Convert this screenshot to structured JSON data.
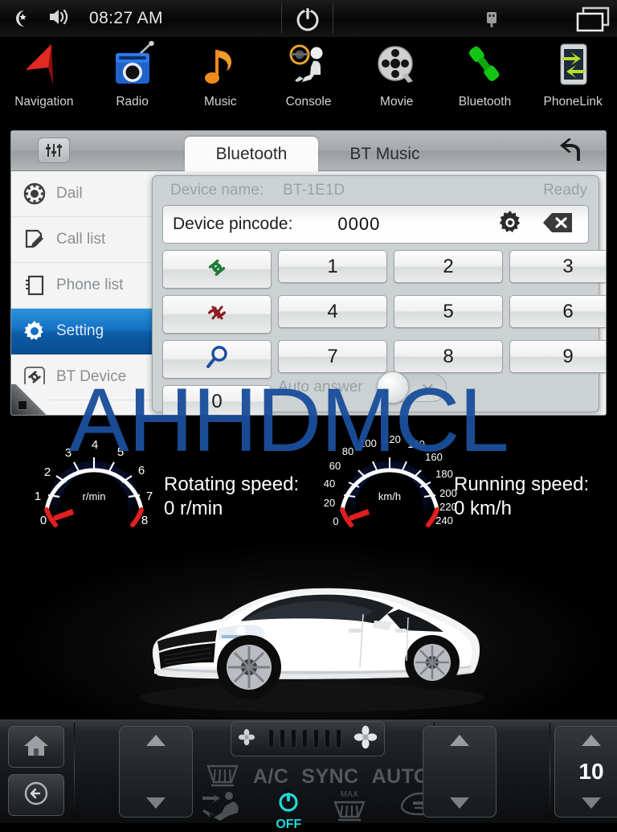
{
  "statusbar": {
    "time": "08:27 AM",
    "icons": [
      "moon-star-icon",
      "volume-icon",
      "power-icon",
      "usb-icon",
      "window-icon"
    ]
  },
  "dock": {
    "apps": [
      {
        "label": "Navigation",
        "icon": "navigation-arrow-icon"
      },
      {
        "label": "Radio",
        "icon": "radio-icon"
      },
      {
        "label": "Music",
        "icon": "music-note-icon"
      },
      {
        "label": "Console",
        "icon": "console-driver-icon"
      },
      {
        "label": "Movie",
        "icon": "film-reel-icon"
      },
      {
        "label": "Bluetooth",
        "icon": "bluetooth-phone-icon"
      },
      {
        "label": "PhoneLink",
        "icon": "phonelink-icon"
      }
    ]
  },
  "bt_panel": {
    "eq_icon": "equalizer-icon",
    "back_icon": "back-arrow-icon",
    "tabs": [
      {
        "label": "Bluetooth",
        "active": true
      },
      {
        "label": "BT Music",
        "active": false
      }
    ],
    "sidebar": [
      {
        "label": "Dail",
        "icon": "rotary-dial-icon",
        "selected": false
      },
      {
        "label": "Call list",
        "icon": "call-list-icon",
        "selected": false
      },
      {
        "label": "Phone list",
        "icon": "phone-book-icon",
        "selected": false
      },
      {
        "label": "Setting",
        "icon": "gear-icon",
        "selected": true
      },
      {
        "label": "BT Device",
        "icon": "link-icon",
        "selected": false
      }
    ],
    "dialog": {
      "device_name_label": "Device name:",
      "device_name_value": "BT-1E1D",
      "status": "Ready",
      "pincode_label": "Device pincode:",
      "pincode_value": "0000",
      "gear_icon": "gear-icon",
      "delete_icon": "backspace-icon",
      "keys": [
        "1",
        "2",
        "3",
        "4",
        "5",
        "6",
        "7",
        "8",
        "9",
        "0"
      ],
      "actions": [
        {
          "name": "connect",
          "icon": "link-connect-icon",
          "color": "#1d7a36"
        },
        {
          "name": "disconnect",
          "icon": "link-break-icon",
          "color": "#8d1a22"
        },
        {
          "name": "search",
          "icon": "magnifier-icon",
          "color": "#1a4f9c"
        }
      ],
      "auto_answer_label": "Auto answer",
      "auto_answer_on": false
    }
  },
  "watermark": "AHHDMCL",
  "gauges": {
    "tacho": {
      "unit": "r/min",
      "ticks": [
        "0",
        "1",
        "2",
        "3",
        "4",
        "5",
        "6",
        "7",
        "8"
      ],
      "readout_label": "Rotating speed:",
      "readout_value": "0 r/min"
    },
    "speedo": {
      "unit": "km/h",
      "ticks": [
        "0",
        "20",
        "40",
        "60",
        "80",
        "100",
        "120",
        "140",
        "160",
        "180",
        "200",
        "220",
        "240"
      ],
      "readout_label": "Running speed:",
      "readout_value": "0 km/h"
    }
  },
  "climate": {
    "home_icon": "home-icon",
    "back_icon": "back-circle-icon",
    "left_temp_up": "▲",
    "left_temp_down": "▼",
    "right_temp_up": "▲",
    "right_temp_down": "▼",
    "fan_low_icon": "fan-small-icon",
    "fan_high_icon": "fan-large-icon",
    "fan_levels": 7,
    "labels": {
      "ac": "A/C",
      "sync": "SYNC",
      "auto": "AUTO",
      "power": "OFF",
      "max": "MAX"
    },
    "icons": [
      "rear-defrost-icon",
      "airflow-icon",
      "power-icon",
      "max-defrost-icon",
      "recirculate-icon"
    ],
    "temp_value": "10",
    "accent_color": "#1fd8dd"
  }
}
